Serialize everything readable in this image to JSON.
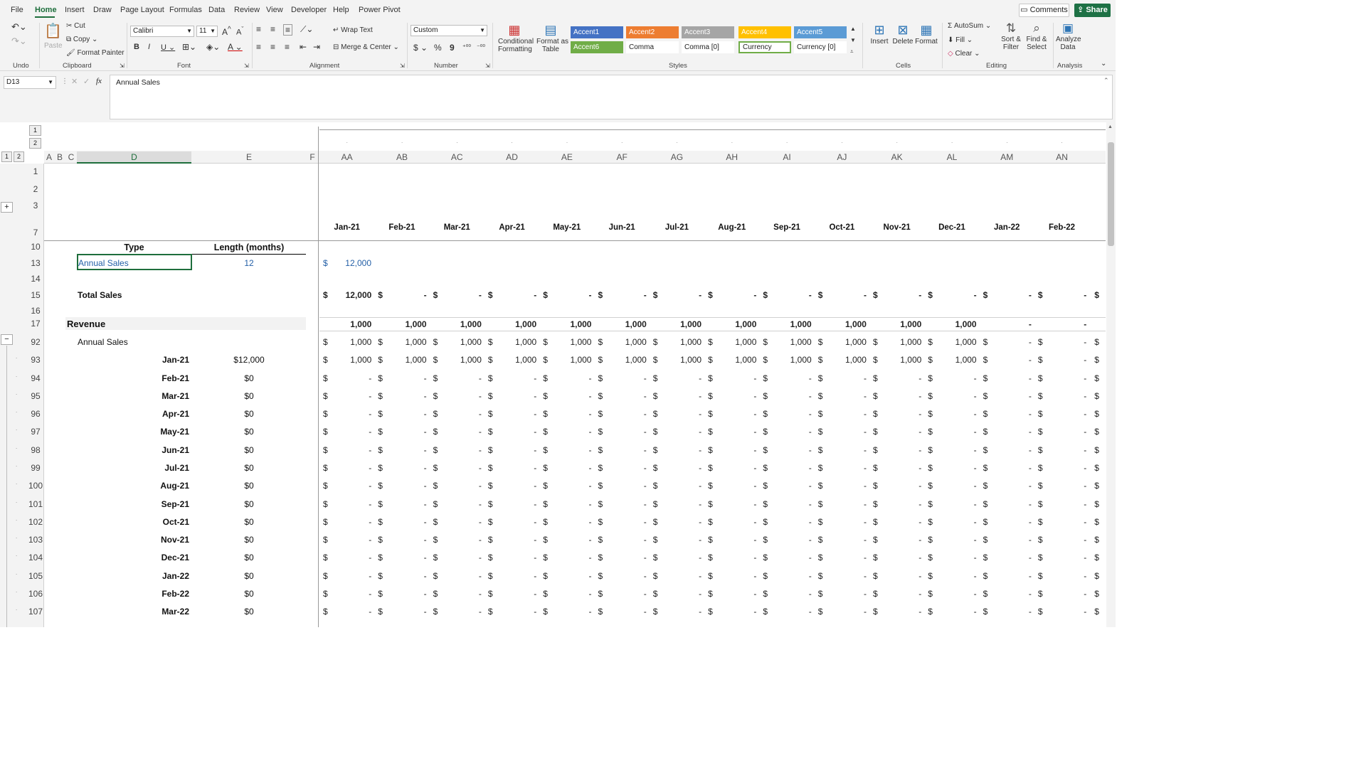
{
  "menu": {
    "items": [
      "File",
      "Home",
      "Insert",
      "Draw",
      "Page Layout",
      "Formulas",
      "Data",
      "Review",
      "View",
      "Developer",
      "Help",
      "Power Pivot"
    ],
    "comments": "Comments",
    "share": "Share"
  },
  "ribbon": {
    "undo_group": "Undo",
    "clipboard_group": "Clipboard",
    "font_group": "Font",
    "alignment_group": "Alignment",
    "number_group": "Number",
    "styles_group": "Styles",
    "cells_group": "Cells",
    "editing_group": "Editing",
    "analysis_group": "Analysis",
    "paste": "Paste",
    "cut": "Cut",
    "copy": "Copy",
    "format_painter": "Format Painter",
    "font_name": "Calibri",
    "font_size": "11",
    "wrap_text": "Wrap Text",
    "merge_center": "Merge & Center",
    "number_format": "Custom",
    "conditional_formatting_1": "Conditional",
    "conditional_formatting_2": "Formatting",
    "format_as_table_1": "Format as",
    "format_as_table_2": "Table",
    "styles": [
      "Accent1",
      "Accent2",
      "Accent3",
      "Accent4",
      "Accent5",
      "Accent6",
      "Comma",
      "Comma [0]",
      "Currency",
      "Currency [0]"
    ],
    "insert": "Insert",
    "delete": "Delete",
    "format": "Format",
    "autosum": "AutoSum",
    "fill": "Fill",
    "clear": "Clear",
    "sort_filter_1": "Sort &",
    "sort_filter_2": "Filter",
    "find_select_1": "Find &",
    "find_select_2": "Select",
    "analyze_data_1": "Analyze",
    "analyze_data_2": "Data"
  },
  "formula_bar": {
    "name_box": "D13",
    "fx": "fx",
    "content": "Annual Sales"
  },
  "colors": {
    "accent1": "#4472c4",
    "accent2": "#ed7d31",
    "accent3": "#a5a5a5",
    "accent4": "#ffc000",
    "accent5": "#5b9bd5",
    "accent6": "#70ad47",
    "brand": "#1e7145"
  },
  "outline": {
    "levels": [
      "1",
      "2"
    ],
    "expand": "+",
    "collapse": "−"
  },
  "columns": {
    "left": [
      "A",
      "B",
      "C",
      "D",
      "E",
      "F"
    ],
    "right": [
      "AA",
      "AB",
      "AC",
      "AD",
      "AE",
      "AF",
      "AG",
      "AH",
      "AI",
      "AJ",
      "AK",
      "AL",
      "AM",
      "AN"
    ]
  },
  "rows": [
    "1",
    "2",
    "3",
    "7",
    "10",
    "13",
    "14",
    "15",
    "16",
    "17",
    "92",
    "93",
    "94",
    "95",
    "96",
    "97",
    "98",
    "99",
    "100",
    "101",
    "102",
    "103",
    "104",
    "105",
    "106",
    "107"
  ],
  "months": [
    "Jan-21",
    "Feb-21",
    "Mar-21",
    "Apr-21",
    "May-21",
    "Jun-21",
    "Jul-21",
    "Aug-21",
    "Sep-21",
    "Oct-21",
    "Nov-21",
    "Dec-21",
    "Jan-22",
    "Feb-22"
  ],
  "table": {
    "type_header": "Type",
    "length_header": "Length (months)",
    "type_value": "Annual Sales",
    "length_value": "12",
    "input_dollar": "$",
    "input_amount": "12,000"
  },
  "total_sales": {
    "label": "Total Sales",
    "values": [
      "12,000",
      "-",
      "-",
      "-",
      "-",
      "-",
      "-",
      "-",
      "-",
      "-",
      "-",
      "-",
      "-",
      "-"
    ]
  },
  "revenue": {
    "label": "Revenue",
    "values": [
      "1,000",
      "1,000",
      "1,000",
      "1,000",
      "1,000",
      "1,000",
      "1,000",
      "1,000",
      "1,000",
      "1,000",
      "1,000",
      "1,000",
      "-",
      "-"
    ]
  },
  "annual_sales_row": {
    "label": "Annual Sales",
    "values": [
      "1,000",
      "1,000",
      "1,000",
      "1,000",
      "1,000",
      "1,000",
      "1,000",
      "1,000",
      "1,000",
      "1,000",
      "1,000",
      "1,000",
      "-",
      "-"
    ]
  },
  "cohort_rows": [
    {
      "month": "Jan-21",
      "amount": "$12,000",
      "values": [
        "1,000",
        "1,000",
        "1,000",
        "1,000",
        "1,000",
        "1,000",
        "1,000",
        "1,000",
        "1,000",
        "1,000",
        "1,000",
        "1,000",
        "-",
        "-"
      ]
    },
    {
      "month": "Feb-21",
      "amount": "$0",
      "values": [
        "-",
        "-",
        "-",
        "-",
        "-",
        "-",
        "-",
        "-",
        "-",
        "-",
        "-",
        "-",
        "-",
        "-"
      ]
    },
    {
      "month": "Mar-21",
      "amount": "$0",
      "values": [
        "-",
        "-",
        "-",
        "-",
        "-",
        "-",
        "-",
        "-",
        "-",
        "-",
        "-",
        "-",
        "-",
        "-"
      ]
    },
    {
      "month": "Apr-21",
      "amount": "$0",
      "values": [
        "-",
        "-",
        "-",
        "-",
        "-",
        "-",
        "-",
        "-",
        "-",
        "-",
        "-",
        "-",
        "-",
        "-"
      ]
    },
    {
      "month": "May-21",
      "amount": "$0",
      "values": [
        "-",
        "-",
        "-",
        "-",
        "-",
        "-",
        "-",
        "-",
        "-",
        "-",
        "-",
        "-",
        "-",
        "-"
      ]
    },
    {
      "month": "Jun-21",
      "amount": "$0",
      "values": [
        "-",
        "-",
        "-",
        "-",
        "-",
        "-",
        "-",
        "-",
        "-",
        "-",
        "-",
        "-",
        "-",
        "-"
      ]
    },
    {
      "month": "Jul-21",
      "amount": "$0",
      "values": [
        "-",
        "-",
        "-",
        "-",
        "-",
        "-",
        "-",
        "-",
        "-",
        "-",
        "-",
        "-",
        "-",
        "-"
      ]
    },
    {
      "month": "Aug-21",
      "amount": "$0",
      "values": [
        "-",
        "-",
        "-",
        "-",
        "-",
        "-",
        "-",
        "-",
        "-",
        "-",
        "-",
        "-",
        "-",
        "-"
      ]
    },
    {
      "month": "Sep-21",
      "amount": "$0",
      "values": [
        "-",
        "-",
        "-",
        "-",
        "-",
        "-",
        "-",
        "-",
        "-",
        "-",
        "-",
        "-",
        "-",
        "-"
      ]
    },
    {
      "month": "Oct-21",
      "amount": "$0",
      "values": [
        "-",
        "-",
        "-",
        "-",
        "-",
        "-",
        "-",
        "-",
        "-",
        "-",
        "-",
        "-",
        "-",
        "-"
      ]
    },
    {
      "month": "Nov-21",
      "amount": "$0",
      "values": [
        "-",
        "-",
        "-",
        "-",
        "-",
        "-",
        "-",
        "-",
        "-",
        "-",
        "-",
        "-",
        "-",
        "-"
      ]
    },
    {
      "month": "Dec-21",
      "amount": "$0",
      "values": [
        "-",
        "-",
        "-",
        "-",
        "-",
        "-",
        "-",
        "-",
        "-",
        "-",
        "-",
        "-",
        "-",
        "-"
      ]
    },
    {
      "month": "Jan-22",
      "amount": "$0",
      "values": [
        "-",
        "-",
        "-",
        "-",
        "-",
        "-",
        "-",
        "-",
        "-",
        "-",
        "-",
        "-",
        "-",
        "-"
      ]
    },
    {
      "month": "Feb-22",
      "amount": "$0",
      "values": [
        "-",
        "-",
        "-",
        "-",
        "-",
        "-",
        "-",
        "-",
        "-",
        "-",
        "-",
        "-",
        "-",
        "-"
      ]
    },
    {
      "month": "Mar-22",
      "amount": "$0",
      "values": [
        "-",
        "-",
        "-",
        "-",
        "-",
        "-",
        "-",
        "-",
        "-",
        "-",
        "-",
        "-",
        "-",
        "-"
      ]
    }
  ],
  "currency_symbol": "$"
}
